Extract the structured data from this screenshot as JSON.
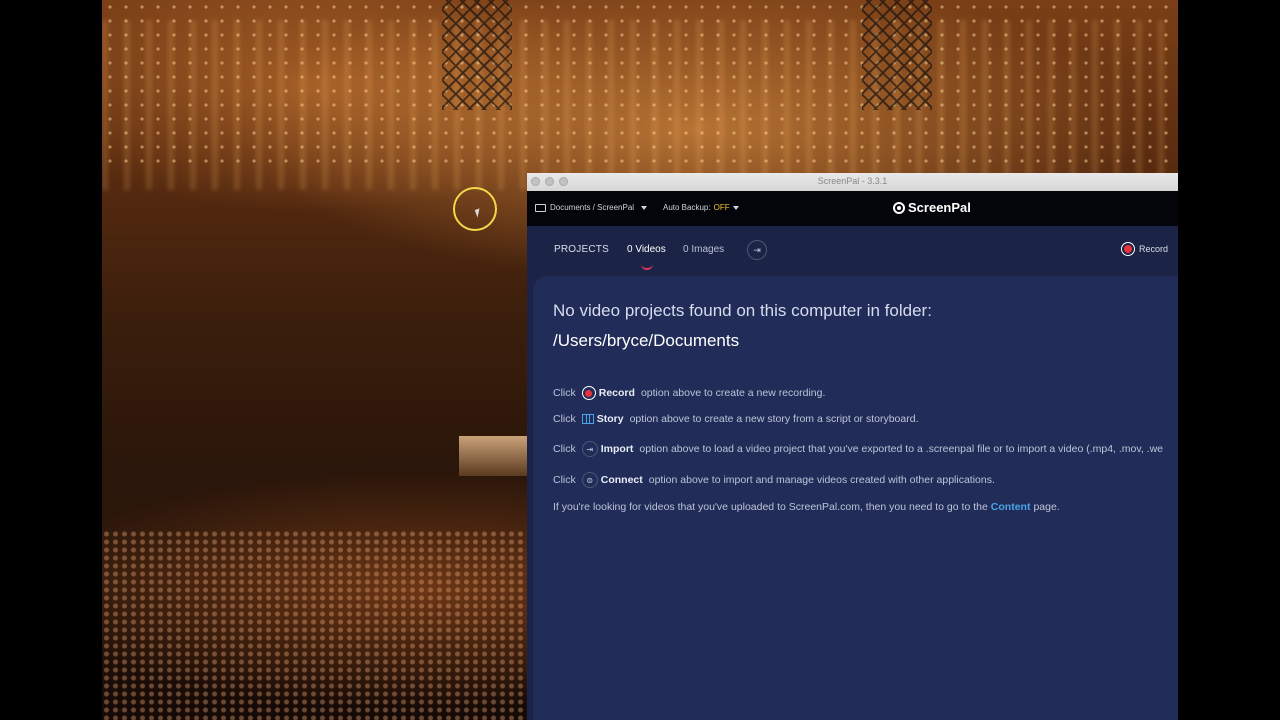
{
  "window": {
    "title": "ScreenPal - 3.3.1"
  },
  "toolbar": {
    "folder_path": "Documents / ScreenPal",
    "auto_backup_label": "Auto Backup:",
    "auto_backup_value": "OFF",
    "logo_text": "ScreenPal"
  },
  "tabs": {
    "projects": "PROJECTS",
    "videos": "0 Videos",
    "images": "0 Images",
    "record": "Record"
  },
  "main": {
    "heading": "No video projects found on this computer in folder:",
    "path": "/Users/bryce/Documents",
    "lines": [
      {
        "prefix": "Click",
        "label": "Record",
        "text": "option above to create a new recording."
      },
      {
        "prefix": "Click",
        "label": "Story",
        "text": "option above to create a new story from a script or storyboard."
      },
      {
        "prefix": "Click",
        "label": "Import",
        "text": "option above to load a video project that you've exported to a .screenpal file or to import a video (.mp4, .mov, .we"
      },
      {
        "prefix": "Click",
        "label": "Connect",
        "text": "option above to import and manage videos created with other applications."
      }
    ],
    "footer_before": "If you're looking for videos that you've uploaded to ScreenPal.com, then you need to go to the",
    "footer_link": "Content",
    "footer_after": "page."
  },
  "colors": {
    "accent": "#e0365b",
    "link": "#4aa3e8",
    "record": "#e8333b",
    "backup_off": "#f0c52c"
  },
  "icons": [
    "folder-icon",
    "chevron-down-icon",
    "screenpal-logo-icon",
    "import-icon",
    "record-icon",
    "story-icon",
    "connect-icon"
  ]
}
